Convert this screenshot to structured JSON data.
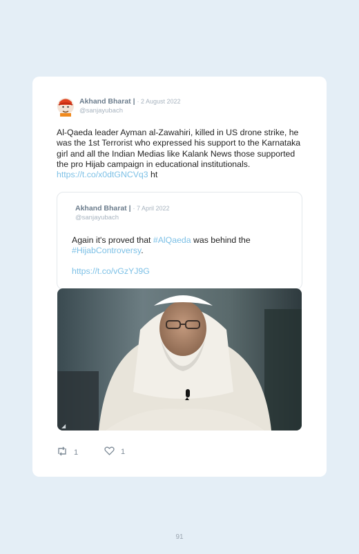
{
  "tweet": {
    "author": "Akhand Bharat",
    "separator": "|",
    "date": "· 2 August 2022",
    "handle": "@sanjayubach",
    "text": "Al-Qaeda leader Ayman al-Zawahiri, killed in US drone strike, he was the 1st Terrorist who expressed his support to the Karnataka girl and all the Indian Medias like Kalank News those supported the pro Hijab campaign in educational institutionals.",
    "link": "https://t.co/x0dtGNCVq3",
    "trail": "ht"
  },
  "quoted": {
    "author": "Akhand Bharat",
    "separator": "|",
    "date": "· 7 April 2022",
    "handle": "@sanjayubach",
    "text_before": "Again it's proved that",
    "hashtag1": "#AlQaeda",
    "text_middle": "was behind the",
    "hashtag2": "#HijabControversy",
    "text_after": ".",
    "url": "https://t.co/vGzYJ9G"
  },
  "actions": {
    "retweet_icon": "retweet-icon",
    "retweets": "1",
    "like_icon": "heart-icon",
    "likes": "1"
  },
  "page_number": "91",
  "colors": {
    "link": "#7cc0e6",
    "background": "#e4eef6",
    "card": "#ffffff"
  }
}
